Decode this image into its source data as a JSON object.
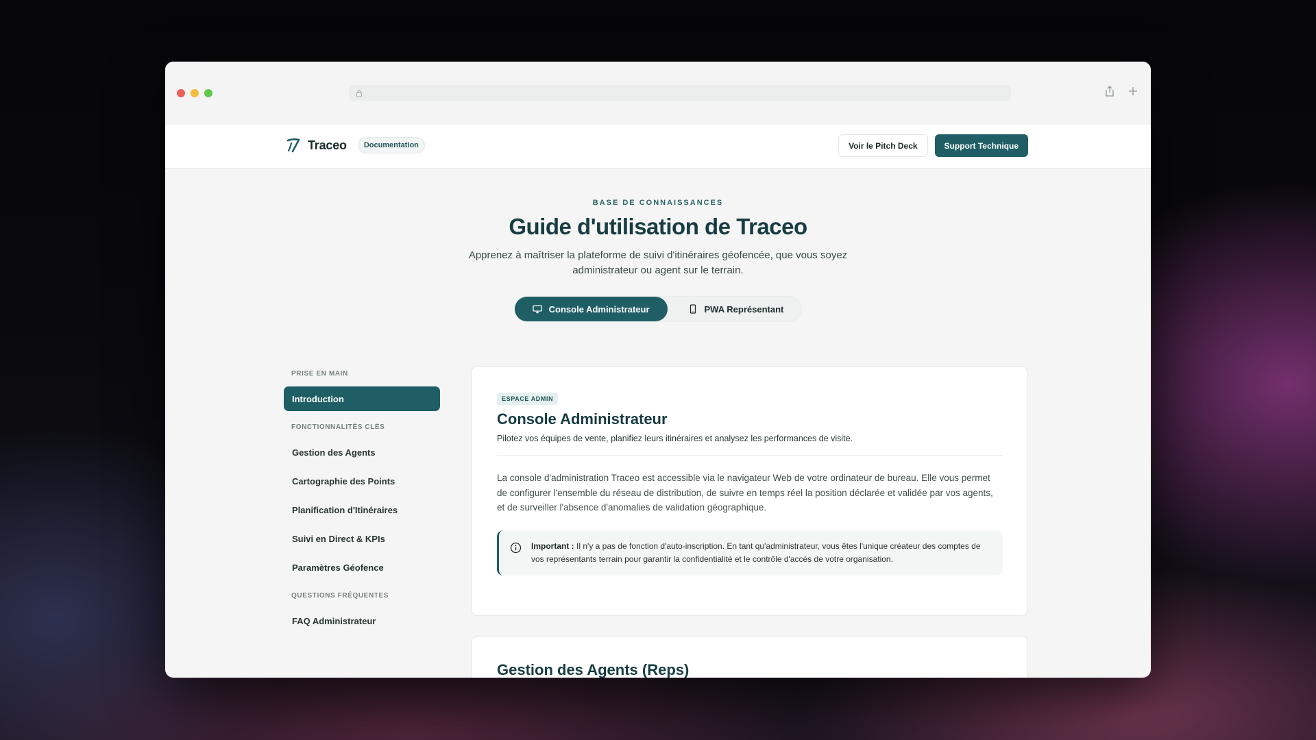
{
  "browser": {
    "url": ""
  },
  "nav": {
    "brand": "Traceo",
    "badge": "Documentation",
    "pitch_button": "Voir le Pitch Deck",
    "support_button": "Support Technique"
  },
  "hero": {
    "eyebrow": "BASE DE CONNAISSANCES",
    "title": "Guide d'utilisation de Traceo",
    "subtitle": "Apprenez à maîtriser la plateforme de suivi d'itinéraires géofencée, que vous soyez administrateur ou agent sur le terrain.",
    "tabs": [
      {
        "label": "Console Administrateur",
        "icon": "monitor-icon",
        "active": true
      },
      {
        "label": "PWA Représentant",
        "icon": "smartphone-icon",
        "active": false
      }
    ]
  },
  "sidebar": {
    "groups": [
      {
        "heading": "PRISE EN MAIN",
        "items": [
          "Introduction"
        ]
      },
      {
        "heading": "FONCTIONNALITÉS CLÉS",
        "items": [
          "Gestion des Agents",
          "Cartographie des Points",
          "Planification d'Itinéraires",
          "Suivi en Direct & KPIs",
          "Paramètres Géofence"
        ]
      },
      {
        "heading": "QUESTIONS FRÉQUENTES",
        "items": [
          "FAQ Administrateur"
        ]
      }
    ],
    "active_item": "Introduction"
  },
  "section1": {
    "tag": "ESPACE ADMIN",
    "title": "Console Administrateur",
    "subtitle": "Pilotez vos équipes de vente, planifiez leurs itinéraires et analysez les performances de visite.",
    "body": "La console d'administration Traceo est accessible via le navigateur Web de votre ordinateur de bureau. Elle vous permet de configurer l'ensemble du réseau de distribution, de suivre en temps réel la position déclarée et validée par vos agents, et de surveiller l'absence d'anomalies de validation géographique.",
    "callout_label": "Important :",
    "callout_text": "Il n'y a pas de fonction d'auto-inscription. En tant qu'administrateur, vous êtes l'unique créateur des comptes de vos représentants terrain pour garantir la confidentialité et le contrôle d'accès de votre organisation."
  },
  "section2": {
    "title": "Gestion des Agents (Reps)"
  },
  "colors": {
    "accent": "#1f5e65",
    "title": "#173c41"
  }
}
